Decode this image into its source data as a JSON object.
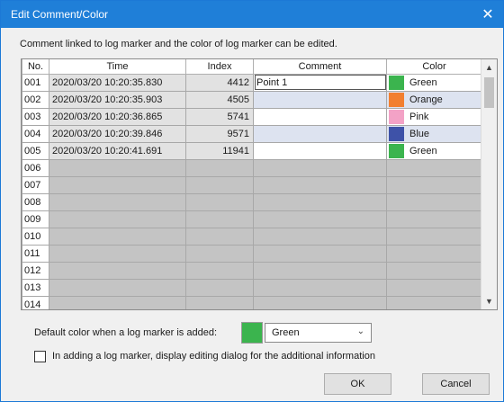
{
  "window": {
    "title": "Edit Comment/Color",
    "close_glyph": "✕"
  },
  "description": "Comment linked to log marker and the color of log marker can be edited.",
  "grid": {
    "columns": [
      "No.",
      "Time",
      "Index",
      "Comment",
      "Color"
    ],
    "rows": [
      {
        "no": "001",
        "time": "2020/03/20 10:20:35.830",
        "index": "4412",
        "comment": "Point 1",
        "color_name": "Green",
        "color_hex": "#3bb44e"
      },
      {
        "no": "002",
        "time": "2020/03/20 10:20:35.903",
        "index": "4505",
        "comment": "",
        "color_name": "Orange",
        "color_hex": "#f27f30"
      },
      {
        "no": "003",
        "time": "2020/03/20 10:20:36.865",
        "index": "5741",
        "comment": "",
        "color_name": "Pink",
        "color_hex": "#f3a2c6"
      },
      {
        "no": "004",
        "time": "2020/03/20 10:20:39.846",
        "index": "9571",
        "comment": "",
        "color_name": "Blue",
        "color_hex": "#3e52a8"
      },
      {
        "no": "005",
        "time": "2020/03/20 10:20:41.691",
        "index": "11941",
        "comment": "",
        "color_name": "Green",
        "color_hex": "#3bb44e"
      },
      {
        "no": "006",
        "time": "",
        "index": "",
        "comment": "",
        "color_name": "",
        "color_hex": ""
      },
      {
        "no": "007",
        "time": "",
        "index": "",
        "comment": "",
        "color_name": "",
        "color_hex": ""
      },
      {
        "no": "008",
        "time": "",
        "index": "",
        "comment": "",
        "color_name": "",
        "color_hex": ""
      },
      {
        "no": "009",
        "time": "",
        "index": "",
        "comment": "",
        "color_name": "",
        "color_hex": ""
      },
      {
        "no": "010",
        "time": "",
        "index": "",
        "comment": "",
        "color_name": "",
        "color_hex": ""
      },
      {
        "no": "011",
        "time": "",
        "index": "",
        "comment": "",
        "color_name": "",
        "color_hex": ""
      },
      {
        "no": "012",
        "time": "",
        "index": "",
        "comment": "",
        "color_name": "",
        "color_hex": ""
      },
      {
        "no": "013",
        "time": "",
        "index": "",
        "comment": "",
        "color_name": "",
        "color_hex": ""
      },
      {
        "no": "014",
        "time": "",
        "index": "",
        "comment": "",
        "color_name": "",
        "color_hex": ""
      }
    ]
  },
  "scrollbar": {
    "up_glyph": "▲",
    "down_glyph": "▼"
  },
  "default_color": {
    "label": "Default color when a log marker is added:",
    "selected": "Green",
    "swatch_hex": "#3bb44e",
    "chevron_glyph": "⌄"
  },
  "display_dialog": {
    "label": "In adding a log marker, display editing dialog for the additional information",
    "checked": false
  },
  "buttons": {
    "ok": "OK",
    "cancel": "Cancel"
  },
  "icons": {
    "close": "close-icon",
    "scroll_up": "chevron-up-icon",
    "scroll_down": "chevron-down-icon",
    "dropdown": "chevron-down-icon"
  }
}
